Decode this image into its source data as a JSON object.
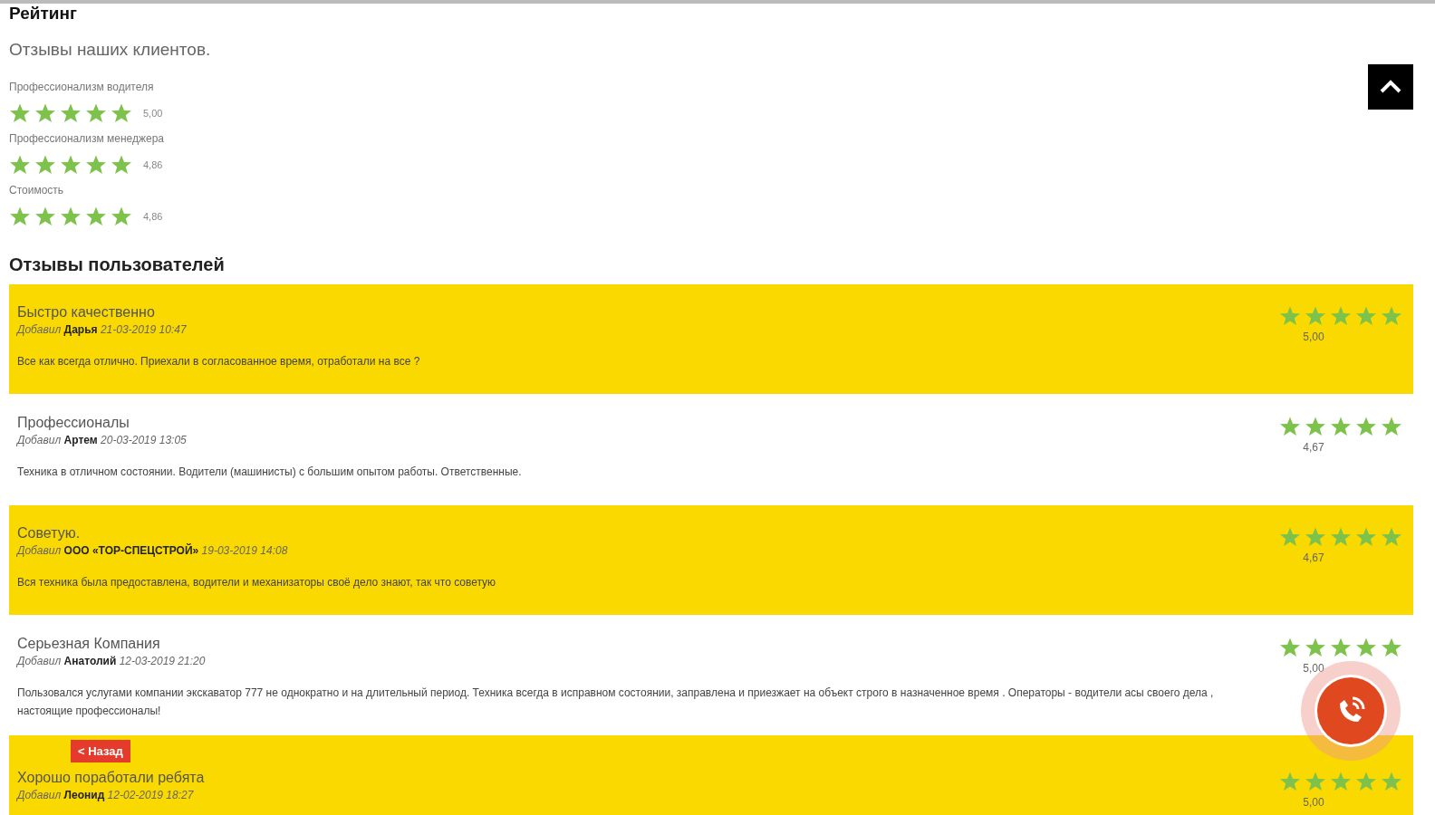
{
  "rating": {
    "title": "Рейтинг",
    "subtitle": "Отзывы наших клиентов.",
    "criteria": [
      {
        "label": "Профессионализм водителя",
        "stars": 5,
        "value": "5,00"
      },
      {
        "label": "Профессионализм менеджера",
        "stars": 5,
        "value": "4,86"
      },
      {
        "label": "Стоимость",
        "stars": 5,
        "value": "4,86"
      }
    ]
  },
  "reviews_heading": "Отзывы пользователей",
  "reviews": [
    {
      "highlighted": true,
      "title": "Быстро качественно",
      "meta": "Добавил **Дарья** *21-03-2019 10:47*",
      "body": "Все как всегда отлично. Приехали в согласованное время, отработали на все ?",
      "stars": 5,
      "value": "5,00"
    },
    {
      "highlighted": false,
      "title": "Профессионалы",
      "meta": "Добавил **Артем** *20-03-2019 13:05*",
      "body": "Техника в отличном состоянии. Водители (машинисты) с большим опытом работы. Ответственные.",
      "stars": 5,
      "value": "4,67"
    },
    {
      "highlighted": true,
      "title": "Советую.",
      "meta": "Добавил **ООО «ТОР-СПЕЦСТРОЙ»** *19-03-2019 14:08*",
      "body": "Вся техника была предоставлена, водители и механизаторы своё дело знают, так что советую",
      "stars": 5,
      "value": "4,67"
    },
    {
      "highlighted": false,
      "title": "Серьезная Компания",
      "meta": "Добавил **Анатолий** *12-03-2019 21:20*",
      "body": "Пользовался услугами компании экскаватор 777 не однократно и на длительный период. Техника всегда в исправном состоянии, заправлена и приезжает на объект строго в назначенное время . Операторы - водители асы своего дела , настоящие профессионалы!",
      "stars": 5,
      "value": "5,00"
    },
    {
      "highlighted": true,
      "title": "Хорошо поработали ребята",
      "meta": "Добавил **Леонид** *12-02-2019 18:27*",
      "stars": 5,
      "value": "5,00"
    }
  ],
  "back_button": "< Назад"
}
